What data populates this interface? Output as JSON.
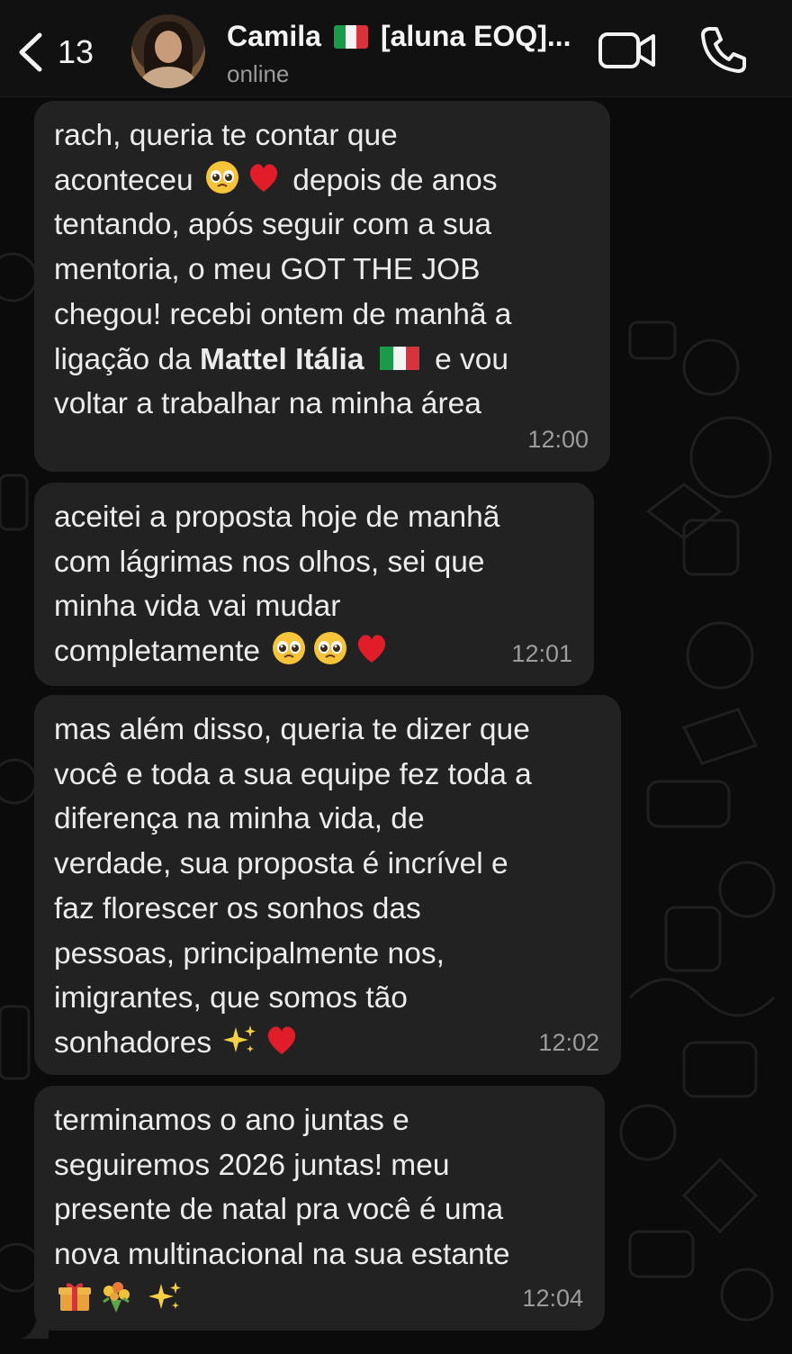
{
  "header": {
    "back_count": "13",
    "contact_name": "Camila",
    "contact_tag": "[aluna EOQ]...",
    "status": "online"
  },
  "messages": [
    {
      "lines": [
        "rach, queria te contar que",
        "aconteceu {pleading}{heart} depois de anos",
        "tentando, após seguir com a sua",
        "mentoria, o meu GOT THE JOB",
        "chegou! recebi ontem de manhã a",
        "ligação da {bold:Mattel Itália} {flag} e vou",
        "voltar a trabalhar na minha área"
      ],
      "time": "12:00"
    },
    {
      "lines": [
        "aceitei a proposta hoje de manhã",
        "com lágrimas nos olhos, sei que",
        "minha vida vai mudar",
        "completamente {pleading}{pleading}{heart}"
      ],
      "time": "12:01"
    },
    {
      "lines": [
        "mas além disso, queria te dizer que",
        "você e toda a sua equipe fez toda a",
        "diferença na minha vida, de",
        "verdade, sua proposta é incrível e",
        "faz florescer os sonhos das",
        "pessoas, principalmente nos,",
        "imigrantes, que somos tão",
        "sonhadores {sparkles}{heart}"
      ],
      "time": "12:02"
    },
    {
      "lines": [
        "terminamos o ano juntas e",
        "seguiremos 2026 juntas! meu",
        "presente de natal pra você é uma",
        "nova multinacional na sua estante",
        "{gift}{bouquet} {sparkles}"
      ],
      "time": "12:04"
    }
  ],
  "colors": {
    "background": "#0b0b0b",
    "header": "#111111",
    "bubble": "#222222",
    "text": "#ececec",
    "timestamp": "#9c9c9c"
  },
  "icons": [
    "chevron-left-icon",
    "video-call-icon",
    "phone-icon",
    "italy-flag-icon"
  ]
}
